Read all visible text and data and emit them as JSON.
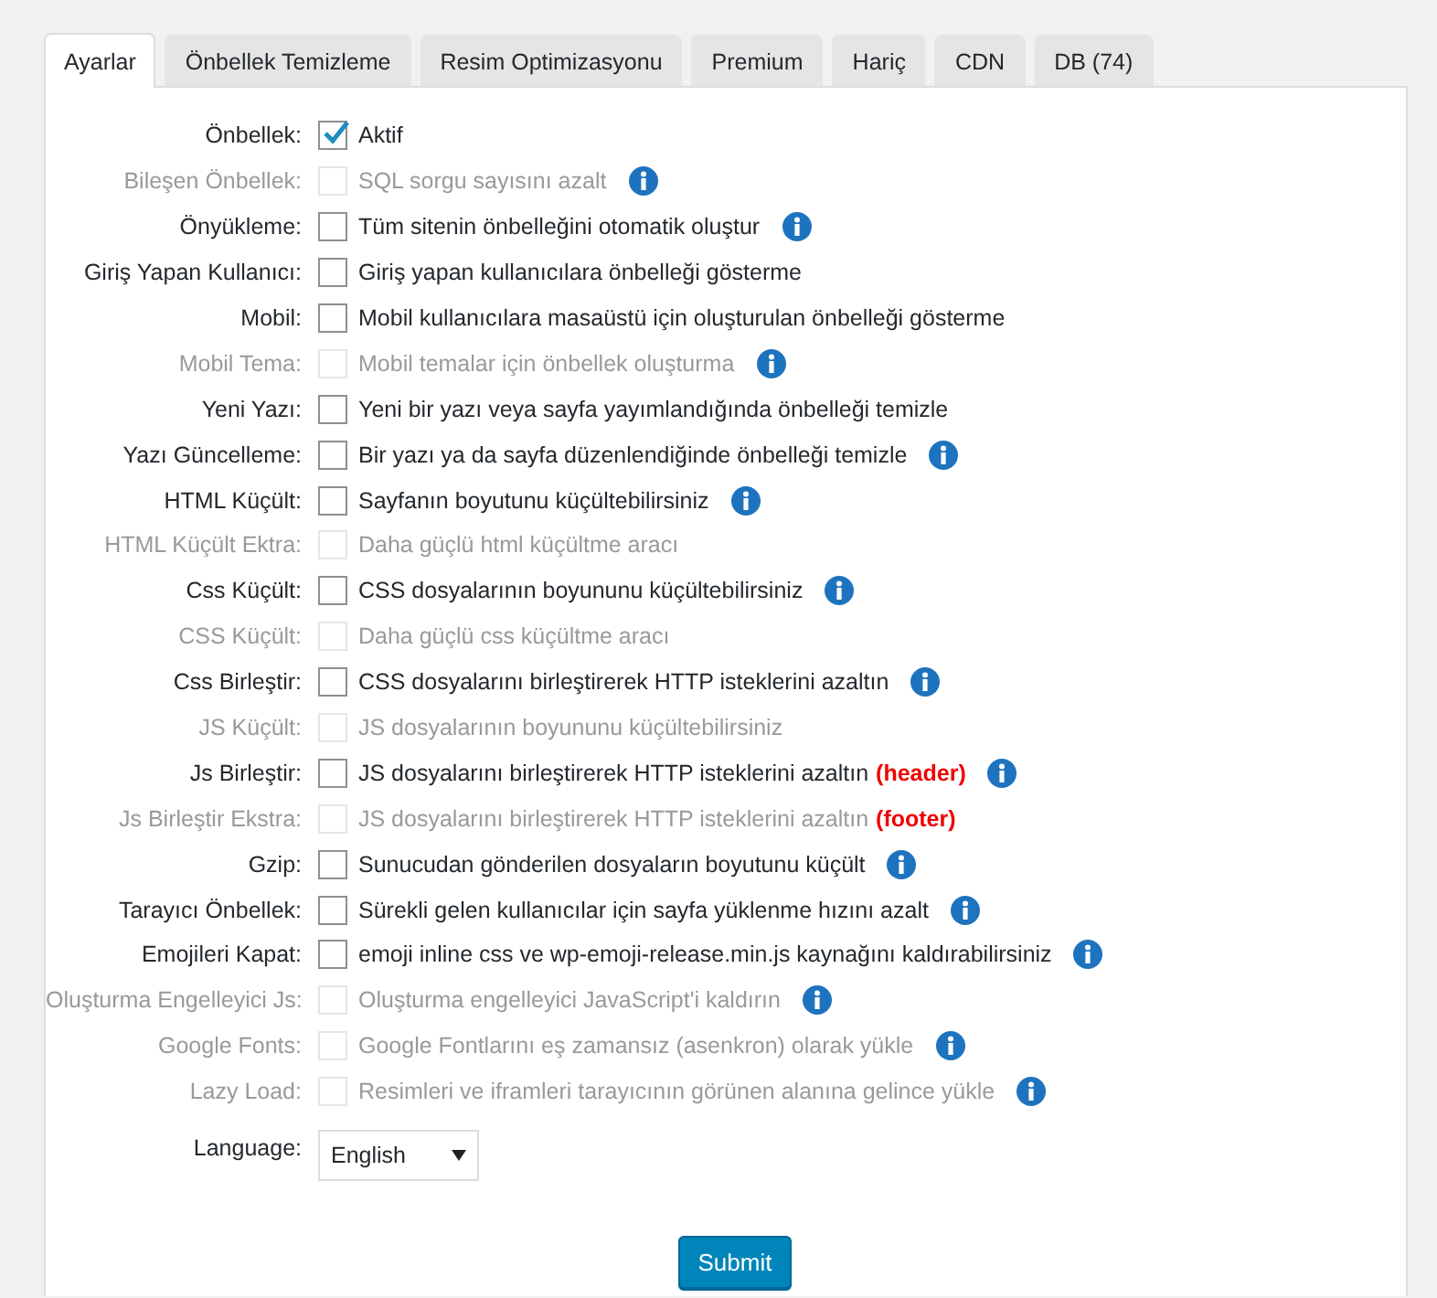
{
  "tabs": [
    {
      "label": "Ayarlar",
      "selected": true
    },
    {
      "label": "Önbellek Temizleme",
      "selected": false
    },
    {
      "label": "Resim Optimizasyonu",
      "selected": false
    },
    {
      "label": "Premium",
      "selected": false
    },
    {
      "label": "Hariç",
      "selected": false
    },
    {
      "label": "CDN",
      "selected": false
    },
    {
      "label": "DB (74)",
      "selected": false
    }
  ],
  "settings": [
    {
      "kind": "checkbox",
      "label": "Önbellek:",
      "text": "Aktif",
      "checked": true,
      "disabled": false,
      "info": false
    },
    {
      "kind": "checkbox",
      "label": "Bileşen Önbellek:",
      "text": "SQL sorgu sayısını azalt",
      "checked": false,
      "disabled": true,
      "info": true
    },
    {
      "kind": "checkbox",
      "label": "Önyükleme:",
      "text": "Tüm sitenin önbelleğini otomatik oluştur",
      "checked": false,
      "disabled": false,
      "info": true
    },
    {
      "kind": "checkbox",
      "label": "Giriş Yapan Kullanıcı:",
      "text": "Giriş yapan kullanıcılara önbelleği gösterme",
      "checked": false,
      "disabled": false,
      "info": false
    },
    {
      "kind": "checkbox",
      "label": "Mobil:",
      "text": "Mobil kullanıcılara masaüstü için oluşturulan önbelleği gösterme",
      "checked": false,
      "disabled": false,
      "info": false
    },
    {
      "kind": "checkbox",
      "label": "Mobil Tema:",
      "text": "Mobil temalar için önbellek oluşturma",
      "checked": false,
      "disabled": true,
      "info": true
    },
    {
      "kind": "checkbox",
      "label": "Yeni Yazı:",
      "text": "Yeni bir yazı veya sayfa yayımlandığında önbelleği temizle",
      "checked": false,
      "disabled": false,
      "info": false
    },
    {
      "kind": "checkbox",
      "label": "Yazı Güncelleme:",
      "text": "Bir yazı ya da sayfa düzenlendiğinde önbelleği temizle",
      "checked": false,
      "disabled": false,
      "info": true
    },
    {
      "kind": "checkbox",
      "label": "HTML Küçült:",
      "text": "Sayfanın boyutunu küçültebilirsiniz",
      "checked": false,
      "disabled": false,
      "info": true
    },
    {
      "kind": "checkbox",
      "label": "HTML Küçült Ektra:",
      "text": "Daha güçlü html küçültme aracı",
      "checked": false,
      "disabled": true,
      "info": false
    },
    {
      "kind": "checkbox",
      "label": "Css Küçült:",
      "text": "CSS dosyalarının boyununu küçültebilirsiniz",
      "checked": false,
      "disabled": false,
      "info": true
    },
    {
      "kind": "checkbox",
      "label": "CSS Küçült:",
      "text": "Daha güçlü css küçültme aracı",
      "checked": false,
      "disabled": true,
      "info": false
    },
    {
      "kind": "checkbox",
      "label": "Css Birleştir:",
      "text": "CSS dosyalarını birleştirerek HTTP isteklerini azaltın",
      "checked": false,
      "disabled": false,
      "info": true
    },
    {
      "kind": "checkbox",
      "label": "JS Küçült:",
      "text": "JS dosyalarının boyununu küçültebilirsiniz",
      "checked": false,
      "disabled": true,
      "info": false
    },
    {
      "kind": "checkbox",
      "label": "Js Birleştir:",
      "text": "JS dosyalarını birleştirerek HTTP isteklerini azaltın",
      "note": "(header)",
      "checked": false,
      "disabled": false,
      "info": true
    },
    {
      "kind": "checkbox",
      "label": "Js Birleştir Ekstra:",
      "text": "JS dosyalarını birleştirerek HTTP isteklerini azaltın",
      "note": "(footer)",
      "checked": false,
      "disabled": true,
      "info": false
    },
    {
      "kind": "checkbox",
      "label": "Gzip:",
      "text": "Sunucudan gönderilen dosyaların boyutunu küçült",
      "checked": false,
      "disabled": false,
      "info": true
    },
    {
      "kind": "checkbox",
      "label": "Tarayıcı Önbellek:",
      "text": "Sürekli gelen kullanıcılar için sayfa yüklenme hızını azalt",
      "checked": false,
      "disabled": false,
      "info": true
    },
    {
      "kind": "checkbox",
      "label": "Emojileri Kapat:",
      "text": "emoji inline css ve wp-emoji-release.min.js kaynağını kaldırabilirsiniz",
      "checked": false,
      "disabled": false,
      "info": true
    },
    {
      "kind": "checkbox",
      "label": "Oluşturma Engelleyici Js:",
      "text": "Oluşturma engelleyici JavaScript'i kaldırın",
      "checked": false,
      "disabled": true,
      "info": true
    },
    {
      "kind": "checkbox",
      "label": "Google Fonts:",
      "text": "Google Fontlarını eş zamansız (asenkron) olarak yükle",
      "checked": false,
      "disabled": true,
      "info": true
    },
    {
      "kind": "checkbox",
      "label": "Lazy Load:",
      "text": "Resimleri ve iframleri tarayıcının görünen alanına gelince yükle",
      "checked": false,
      "disabled": true,
      "info": true
    },
    {
      "kind": "select",
      "label": "Language:",
      "value": "English"
    }
  ],
  "submit": "Submit"
}
